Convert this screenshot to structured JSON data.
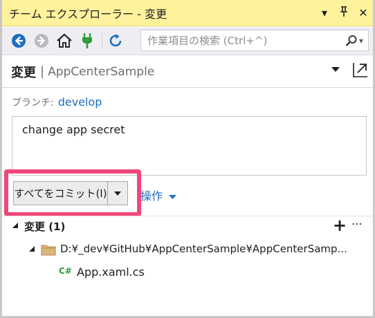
{
  "window": {
    "title": "チーム エクスプローラー - 変更",
    "dropdown_glyph": "▾",
    "pin_glyph": "⊥",
    "close_glyph": "✕"
  },
  "toolbar": {
    "search_placeholder": "作業項目の検索 (Ctrl+^)",
    "search_dropdown_glyph": "▾"
  },
  "header": {
    "title": "変更",
    "separator": "|",
    "repository": "AppCenterSample"
  },
  "branch": {
    "label": "ブランチ:",
    "value": "develop"
  },
  "commit_message": "change app secret",
  "commit_button": {
    "label": "すべてをコミット(I)"
  },
  "actions": {
    "label": "操作"
  },
  "changes": {
    "title": "変更 (1)",
    "folder_path": "D:¥_dev¥GitHub¥AppCenterSample¥AppCenterSamp...",
    "file_badge": "C#",
    "file_name": "App.xaml.cs"
  },
  "colors": {
    "title_bar": "#fff29d",
    "accent_link": "#1e6ec1",
    "highlight_border": "#f0467a",
    "plug_icon": "#2e9c3c",
    "nav_back": "#1e6ec1"
  }
}
